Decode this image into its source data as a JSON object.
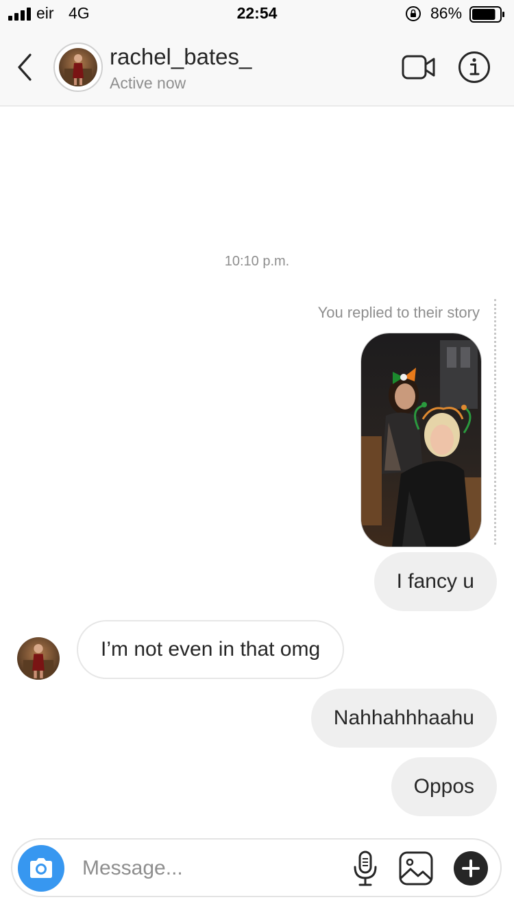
{
  "status_bar": {
    "carrier": "eir",
    "network": "4G",
    "time": "22:54",
    "battery_percent": "86%",
    "battery_level": 0.86,
    "icons": [
      "signal-bars-icon",
      "orientation-lock-icon",
      "battery-icon"
    ]
  },
  "header": {
    "username": "rachel_bates_",
    "status": "Active now",
    "icons": [
      "back-chevron-icon",
      "video-camera-icon",
      "info-icon"
    ]
  },
  "thread": {
    "timestamp": "10:10 p.m.",
    "story_reply_caption": "You replied to their story",
    "messages": [
      {
        "sender": "me",
        "text": "I fancy u"
      },
      {
        "sender": "them",
        "text": "I’m not even in that omg"
      },
      {
        "sender": "me",
        "text": "Nahhahhhaahu"
      },
      {
        "sender": "me",
        "text": "Oppos"
      }
    ]
  },
  "composer": {
    "placeholder": "Message...",
    "icons": [
      "camera-icon",
      "microphone-icon",
      "gallery-icon",
      "plus-icon"
    ]
  },
  "colors": {
    "accent": "#3797f0",
    "outgoing_bubble": "#efefef",
    "secondary_text": "#8e8e8e",
    "primary_text": "#262626"
  }
}
